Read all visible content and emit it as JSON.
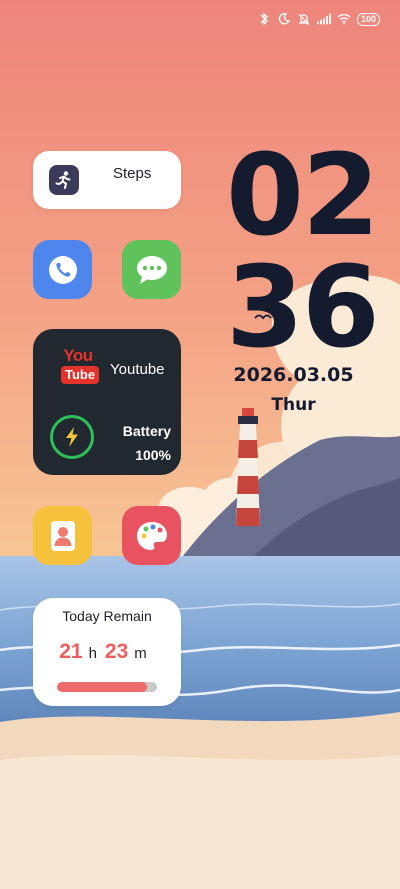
{
  "status_bar": {
    "icons": [
      "bluetooth-icon",
      "moon-icon",
      "bell-off-icon",
      "signal-icon",
      "wifi-icon"
    ],
    "battery_level": "100"
  },
  "steps_widget": {
    "label": "Steps",
    "icon": "running-person-icon"
  },
  "apps": [
    {
      "name": "Phone",
      "icon": "phone-icon",
      "color": "#4f86ee"
    },
    {
      "name": "Messages",
      "icon": "chat-bubble-icon",
      "color": "#5fc25a"
    },
    {
      "name": "Contacts",
      "icon": "contact-card-icon",
      "color": "#f7c23b"
    },
    {
      "name": "Themes",
      "icon": "palette-icon",
      "color": "#e85261"
    }
  ],
  "media_widget": {
    "youtube_logo_top": "You",
    "youtube_logo_bottom": "Tube",
    "youtube_label": "Youtube",
    "battery_label": "Battery",
    "battery_value": "100%"
  },
  "remain_widget": {
    "title": "Today Remain",
    "hours": "21",
    "hours_unit": "h",
    "minutes": "23",
    "minutes_unit": "m",
    "progress_fraction": 0.9
  },
  "clock": {
    "hour": "02",
    "minute": "36",
    "date": "2026.03.05",
    "weekday": "Thur"
  },
  "colors": {
    "sky_top": "#ef8a7e",
    "sky_bottom": "#f6c796",
    "sea": "#7fa7d6",
    "sand": "#f6e3cf",
    "clock_text": "#141b2e",
    "accent_red": "#ef5d5d"
  }
}
